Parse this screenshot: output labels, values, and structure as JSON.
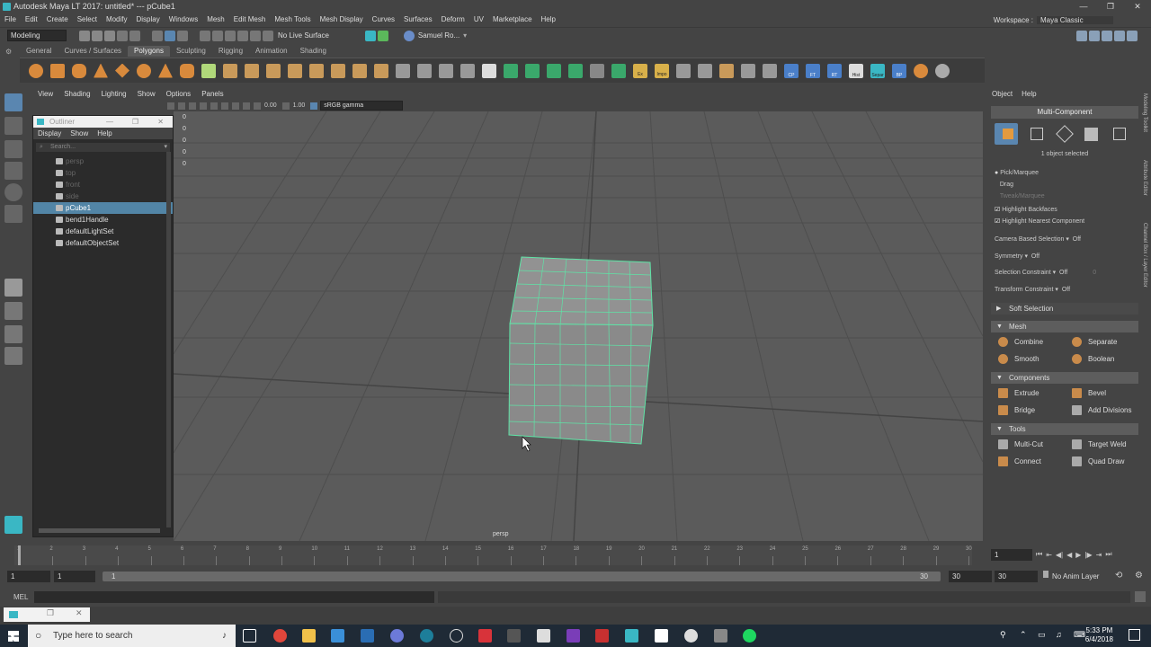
{
  "title": {
    "text": "Autodesk Maya LT 2017: untitled*   ---   pCube1",
    "min": "—",
    "max": "❐",
    "close": "✕"
  },
  "menu": {
    "items": [
      "File",
      "Edit",
      "Create",
      "Select",
      "Modify",
      "Display",
      "Windows",
      "Mesh",
      "Edit Mesh",
      "Mesh Tools",
      "Mesh Display",
      "Curves",
      "Surfaces",
      "Deform",
      "UV",
      "Marketplace",
      "Help"
    ],
    "workspace_label": "Workspace :",
    "workspace_value": "Maya Classic"
  },
  "status": {
    "mode": "Modeling",
    "live_surface": "No Live Surface",
    "user": "Samuel Ro..."
  },
  "shelf_tabs": [
    "General",
    "Curves / Surfaces",
    "Polygons",
    "Sculpting",
    "Rigging",
    "Animation",
    "Shading"
  ],
  "shelf_active": "Polygons",
  "shelf_labels": {
    "cp": "CP",
    "ft": "FT",
    "rt": "RT",
    "hist": "Hist",
    "separ": "Separ",
    "bp": "BP",
    "ex": "Ex",
    "impo": "Impo"
  },
  "panel_menu": [
    "View",
    "Shading",
    "Lighting",
    "Show",
    "Options",
    "Panels"
  ],
  "panel_toolbar": {
    "value1": "0.00",
    "value2": "1.00",
    "colorspace": "sRGB gamma"
  },
  "viewport": {
    "camera_label": "persp",
    "hud_values": [
      "0",
      "0",
      "0",
      "0",
      "0"
    ]
  },
  "outliner": {
    "title": "Outliner",
    "menu": [
      "Display",
      "Show",
      "Help"
    ],
    "search_placeholder": "Search...",
    "items": [
      {
        "label": "persp",
        "state": "dim"
      },
      {
        "label": "top",
        "state": "dim"
      },
      {
        "label": "front",
        "state": "dim"
      },
      {
        "label": "side",
        "state": "dim"
      },
      {
        "label": "pCube1",
        "state": "sel"
      },
      {
        "label": "bend1Handle",
        "state": ""
      },
      {
        "label": "defaultLightSet",
        "state": ""
      },
      {
        "label": "defaultObjectSet",
        "state": ""
      }
    ]
  },
  "modeling_toolkit": {
    "menu": [
      "Object",
      "Help"
    ],
    "mode": "Multi-Component",
    "selected_info": "1 object selected",
    "pick_marquee": "Pick/Marquee",
    "drag": "Drag",
    "tweak_marquee": "Tweak/Marquee",
    "highlight_backfaces": "Highlight Backfaces",
    "highlight_nearest": "Highlight Nearest Component",
    "camera_based": "Camera Based Selection",
    "symmetry": "Symmetry",
    "selection_constraint": "Selection Constraint",
    "transform_constraint": "Transform Constraint",
    "off": "Off",
    "zero": "0",
    "soft_selection": "Soft Selection",
    "mesh_title": "Mesh",
    "combine": "Combine",
    "separate": "Separate",
    "smooth": "Smooth",
    "boolean": "Boolean",
    "components_title": "Components",
    "extrude": "Extrude",
    "bevel": "Bevel",
    "bridge": "Bridge",
    "add_divisions": "Add Divisions",
    "tools_title": "Tools",
    "multi_cut": "Multi-Cut",
    "target_weld": "Target Weld",
    "connect": "Connect",
    "quad_draw": "Quad Draw"
  },
  "side_tabs": [
    "Modeling Toolkit",
    "Attribute Editor",
    "Channel Box / Layer Editor"
  ],
  "timeline": {
    "ticks": [
      "1",
      "2",
      "3",
      "4",
      "5",
      "6",
      "7",
      "8",
      "9",
      "10",
      "11",
      "12",
      "13",
      "14",
      "15",
      "16",
      "17",
      "18",
      "19",
      "20",
      "21",
      "22",
      "23",
      "24",
      "25",
      "26",
      "27",
      "28",
      "29",
      "30"
    ],
    "current": "1"
  },
  "range": {
    "start": "1",
    "start2": "1",
    "bar_start": "1",
    "bar_end": "30",
    "end": "30",
    "end2": "30",
    "anim_layer": "No Anim Layer"
  },
  "cmd": {
    "label": "MEL"
  },
  "taskbar": {
    "search": "Type here to search",
    "time": "5:33 PM",
    "date": "6/4/2018"
  }
}
